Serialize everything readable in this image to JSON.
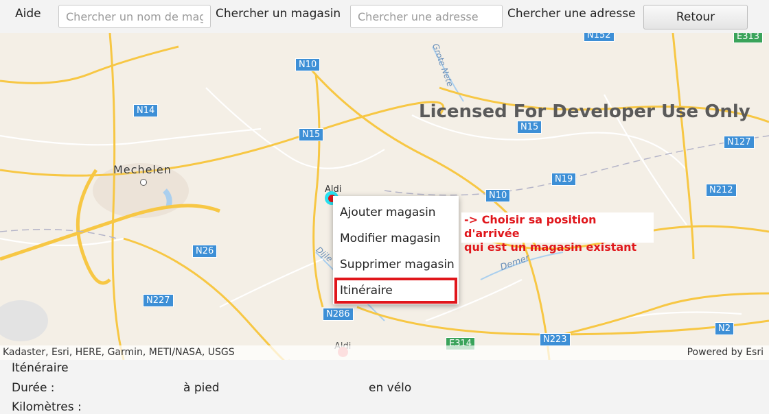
{
  "toolbar": {
    "help_label": "Aide",
    "store_search": {
      "placeholder": "Chercher un nom de magasin",
      "button_label": "Chercher un magasin"
    },
    "address_search": {
      "placeholder": "Chercher une adresse",
      "button_label": "Chercher une adresse"
    },
    "back_label": "Retour"
  },
  "map": {
    "watermark": "Licensed For Developer Use Only",
    "city_label": "Mechelen",
    "road_labels": [
      "N10",
      "N14",
      "N15",
      "N15",
      "N19",
      "N10",
      "N127",
      "N212",
      "N26",
      "N227",
      "N286",
      "N223",
      "N2",
      "N152",
      "E314",
      "E313"
    ],
    "water_labels": [
      "Dijle",
      "Demer",
      "Grote Nete"
    ],
    "markers": [
      {
        "label": "Aldi",
        "state": "selected"
      },
      {
        "label": "Aldi",
        "state": "normal"
      }
    ],
    "attribution_left": "Kadaster, Esri, HERE, Garmin, METI/NASA, USGS",
    "attribution_right": "Powered by Esri"
  },
  "context_menu": {
    "items": [
      "Ajouter magasin",
      "Modifier magasin",
      "Supprimer magasin",
      "Itinéraire"
    ],
    "highlighted_item": "Itinéraire"
  },
  "annotation": {
    "line1": "-> Choisir sa position d'arrivée",
    "line2": "qui est un magasin existant"
  },
  "route_panel": {
    "title": "Iténéraire",
    "duration_label": "Durée :",
    "walk_label": "à pied",
    "bike_label": "en vélo",
    "km_label": "Kilomètres :"
  },
  "colors": {
    "highlight_red": "#e0161b",
    "road_yellow": "#f7c744",
    "shield_blue": "#3d8fd6",
    "map_background": "#f4efe6",
    "marker_cyan": "#28e0f0",
    "marker_red": "#e0161b"
  }
}
